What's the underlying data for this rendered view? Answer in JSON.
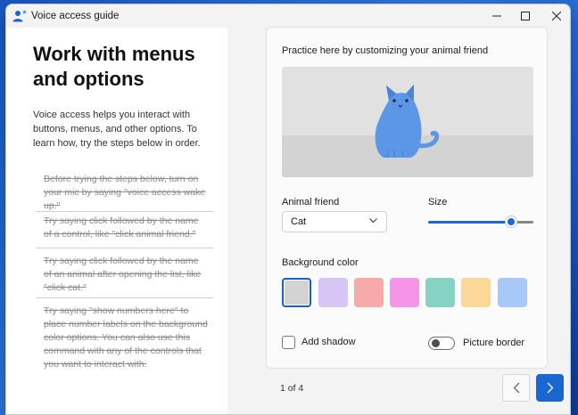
{
  "window": {
    "title": "Voice access guide",
    "icon": "voice-access-person-icon",
    "controls": {
      "minimize_icon": "minimize-icon",
      "maximize_icon": "maximize-icon",
      "close_icon": "close-icon"
    }
  },
  "guide": {
    "heading_line1": "Work with menus",
    "heading_line2": "and options",
    "intro": "Voice access helps you interact with buttons, menus, and other options. To learn how, try the steps below in order.",
    "steps": [
      "Before trying the steps below, turn on your mic by saying \"voice access wake up.\"",
      "Try saying click followed by the name of a control, like \"click animal friend.\"",
      "Try saying click followed by the name of an animal after opening the list, like \"click cat.\"",
      "Try saying \"show numbers here\" to place number labels on the background color options. You can also use this command with any of the controls that you want to interact with."
    ],
    "steps_state": "completed-strikethrough"
  },
  "practice": {
    "label": "Practice here by customizing your animal friend",
    "preview_icon": "cat-icon",
    "animal_friend_label": "Animal friend",
    "animal_friend_value": "Cat",
    "size_label": "Size",
    "size_value_fraction": 0.78,
    "background_color_label": "Background color",
    "background_colors": [
      "#d3d3d3",
      "#d7c5f5",
      "#f6aaaa",
      "#f594e8",
      "#86d3c4",
      "#fcd79a",
      "#a8c9f7"
    ],
    "selected_background_index": 0,
    "add_shadow_label": "Add shadow",
    "add_shadow_checked": false,
    "picture_border_label": "Picture border",
    "picture_border_on": false,
    "cat_color": "#5b97e6"
  },
  "footer": {
    "page_indicator": "1 of 4",
    "prev_icon": "chevron-left-icon",
    "next_icon": "chevron-right-icon",
    "accent": "#1a67d2"
  }
}
